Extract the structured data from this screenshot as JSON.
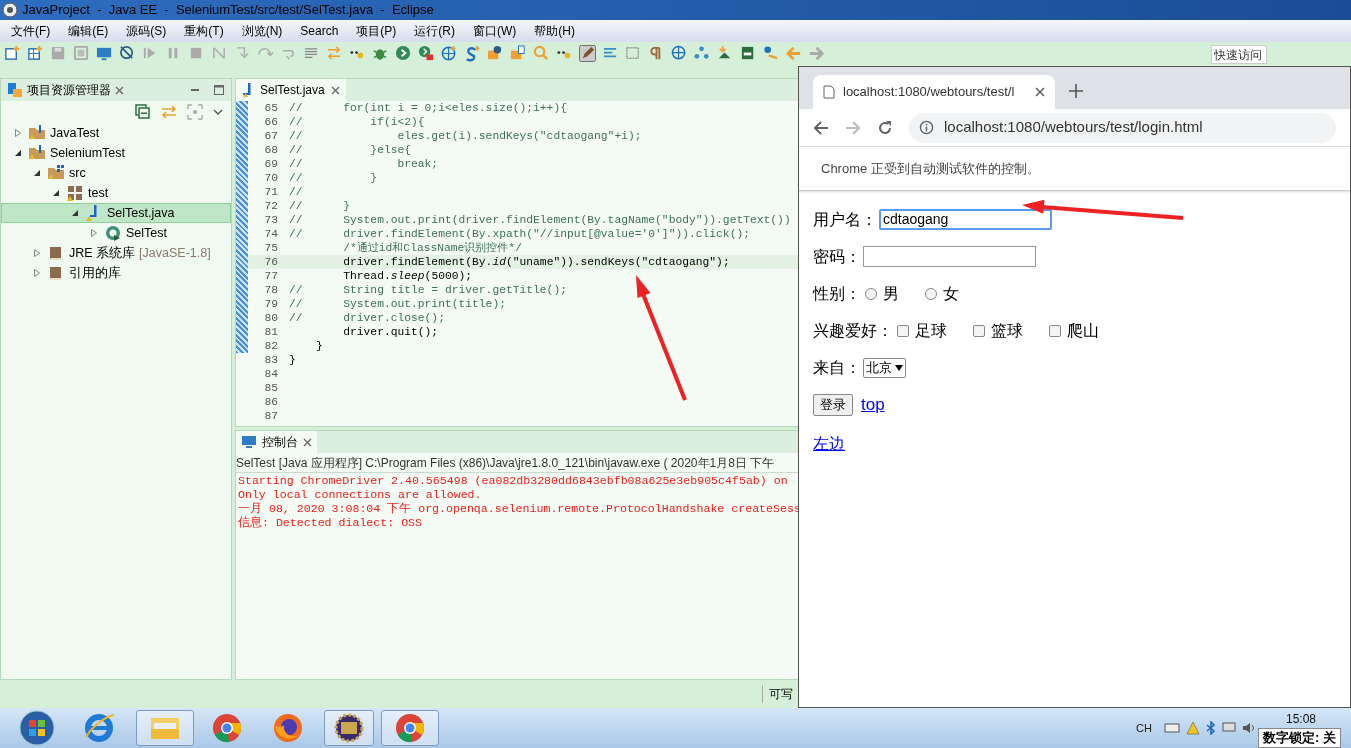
{
  "window": {
    "title": "JavaProject  -  Java EE  -  SeleniumTest/src/test/SelTest.java  -  Eclipse"
  },
  "menu": [
    "文件(F)",
    "编辑(E)",
    "源码(S)",
    "重构(T)",
    "浏览(N)",
    "Search",
    "项目(P)",
    "运行(R)",
    "窗口(W)",
    "帮助(H)"
  ],
  "quick_access": {
    "placeholder": "快速访问"
  },
  "explorer": {
    "title": "项目资源管理器",
    "tree": [
      {
        "label": "JavaTest",
        "kind": "project",
        "expanded": false,
        "selected": false
      },
      {
        "label": "SeleniumTest",
        "kind": "project",
        "expanded": true,
        "selected": false,
        "children": [
          {
            "label": "src",
            "kind": "source-folder",
            "expanded": true,
            "selected": false,
            "children": [
              {
                "label": "test",
                "kind": "package",
                "expanded": true,
                "selected": false,
                "children": [
                  {
                    "label": "SelTest.java",
                    "kind": "java-file",
                    "expanded": true,
                    "selected": true,
                    "children": [
                      {
                        "label": "SelTest",
                        "kind": "class",
                        "expanded": false,
                        "selected": false
                      }
                    ]
                  }
                ]
              }
            ]
          },
          {
            "label": "JRE 系统库",
            "decoration": "[JavaSE-1.8]",
            "kind": "library",
            "expanded": false,
            "selected": false
          },
          {
            "label": "引用的库",
            "kind": "library",
            "expanded": false,
            "selected": false
          }
        ]
      }
    ]
  },
  "editor": {
    "tab": "SelTest.java",
    "lines": [
      {
        "number": "65",
        "kind": "comment",
        "text": "//      for(int i = 0;i<eles.size();i++){"
      },
      {
        "number": "66",
        "kind": "comment",
        "text": "//          if(i<2){"
      },
      {
        "number": "67",
        "kind": "comment",
        "text": "//              eles.get(i).sendKeys(\"cdtaogang\"+i);"
      },
      {
        "number": "68",
        "kind": "comment",
        "text": "//          }else{"
      },
      {
        "number": "69",
        "kind": "comment",
        "text": "//              break;"
      },
      {
        "number": "70",
        "kind": "comment",
        "text": "//          }"
      },
      {
        "number": "71",
        "kind": "comment",
        "text": "//"
      },
      {
        "number": "72",
        "kind": "comment",
        "text": "//      }"
      },
      {
        "number": "73",
        "kind": "comment",
        "text": "//      System.out.print(driver.findElement(By.tagName(\"body\")).getText())"
      },
      {
        "number": "74",
        "kind": "comment",
        "text": "//      driver.findElement(By.xpath(\"//input[@value='0']\")).click();"
      },
      {
        "number": "75",
        "kind": "comment",
        "text": "        /*通过id和ClassName识别控件*/"
      },
      {
        "number": "76",
        "kind": "code",
        "current": true,
        "text": "        driver.findElement(By.*id*(\"uname\")).sendKeys(\"cdtaogang\");"
      },
      {
        "number": "77",
        "kind": "code",
        "current": false,
        "text": "        Thread.*sleep*(5000);"
      },
      {
        "number": "78",
        "kind": "comment",
        "text": "//      String title = driver.getTitle();"
      },
      {
        "number": "79",
        "kind": "comment",
        "text": "//      System.out.print(title);"
      },
      {
        "number": "80",
        "kind": "comment",
        "text": "//      driver.close();"
      },
      {
        "number": "81",
        "kind": "code",
        "current": false,
        "text": "        driver.quit();"
      },
      {
        "number": "82",
        "kind": "code",
        "current": false,
        "text": "    }"
      },
      {
        "number": "83",
        "kind": "code",
        "current": false,
        "text": "}"
      },
      {
        "number": "84",
        "kind": "blank"
      },
      {
        "number": "85",
        "kind": "blank"
      },
      {
        "number": "86",
        "kind": "blank"
      },
      {
        "number": "87",
        "kind": "blank"
      }
    ]
  },
  "console": {
    "tab": "控制台",
    "header": "SelTest [Java 应用程序] C:\\Program Files (x86)\\Java\\jre1.8.0_121\\bin\\javaw.exe ( 2020年1月8日 下午",
    "lines": [
      "Starting ChromeDriver 2.40.565498 (ea082db3280dd6843ebfb08a625e3eb905c4f5ab) on",
      "Only local connections are allowed.",
      "一月 08, 2020 3:08:04 下午 org.openqa.selenium.remote.ProtocolHandshake createSess",
      "信息: Detected dialect: OSS"
    ]
  },
  "status_bar": {
    "text": "可写"
  },
  "browser": {
    "tab_title": "localhost:1080/webtours/test/l",
    "url": "localhost:1080/webtours/test/login.html",
    "infobar": "Chrome 正受到自动测试软件的控制。",
    "form": [
      {
        "kind": "text",
        "label": "用户名：",
        "value": "cdtaogang",
        "focused": true
      },
      {
        "kind": "password",
        "label": "密码：",
        "focused": false
      },
      {
        "kind": "radio",
        "label": "性别：",
        "options": [
          {
            "label": "男",
            "checked": false
          },
          {
            "label": "女",
            "checked": false
          }
        ]
      },
      {
        "kind": "checkbox",
        "label": "兴趣爱好：",
        "options": [
          {
            "label": "足球",
            "checked": false
          },
          {
            "label": "篮球",
            "checked": false
          },
          {
            "label": "爬山",
            "checked": false
          }
        ]
      },
      {
        "kind": "select",
        "label": "来自：",
        "value": "北京"
      },
      {
        "kind": "actions",
        "button": "登录",
        "link": "top"
      },
      {
        "kind": "link",
        "link": "左边"
      }
    ]
  },
  "taskbar": {
    "language": "CH",
    "time": "15:08",
    "numlock": "数字锁定: 关"
  }
}
